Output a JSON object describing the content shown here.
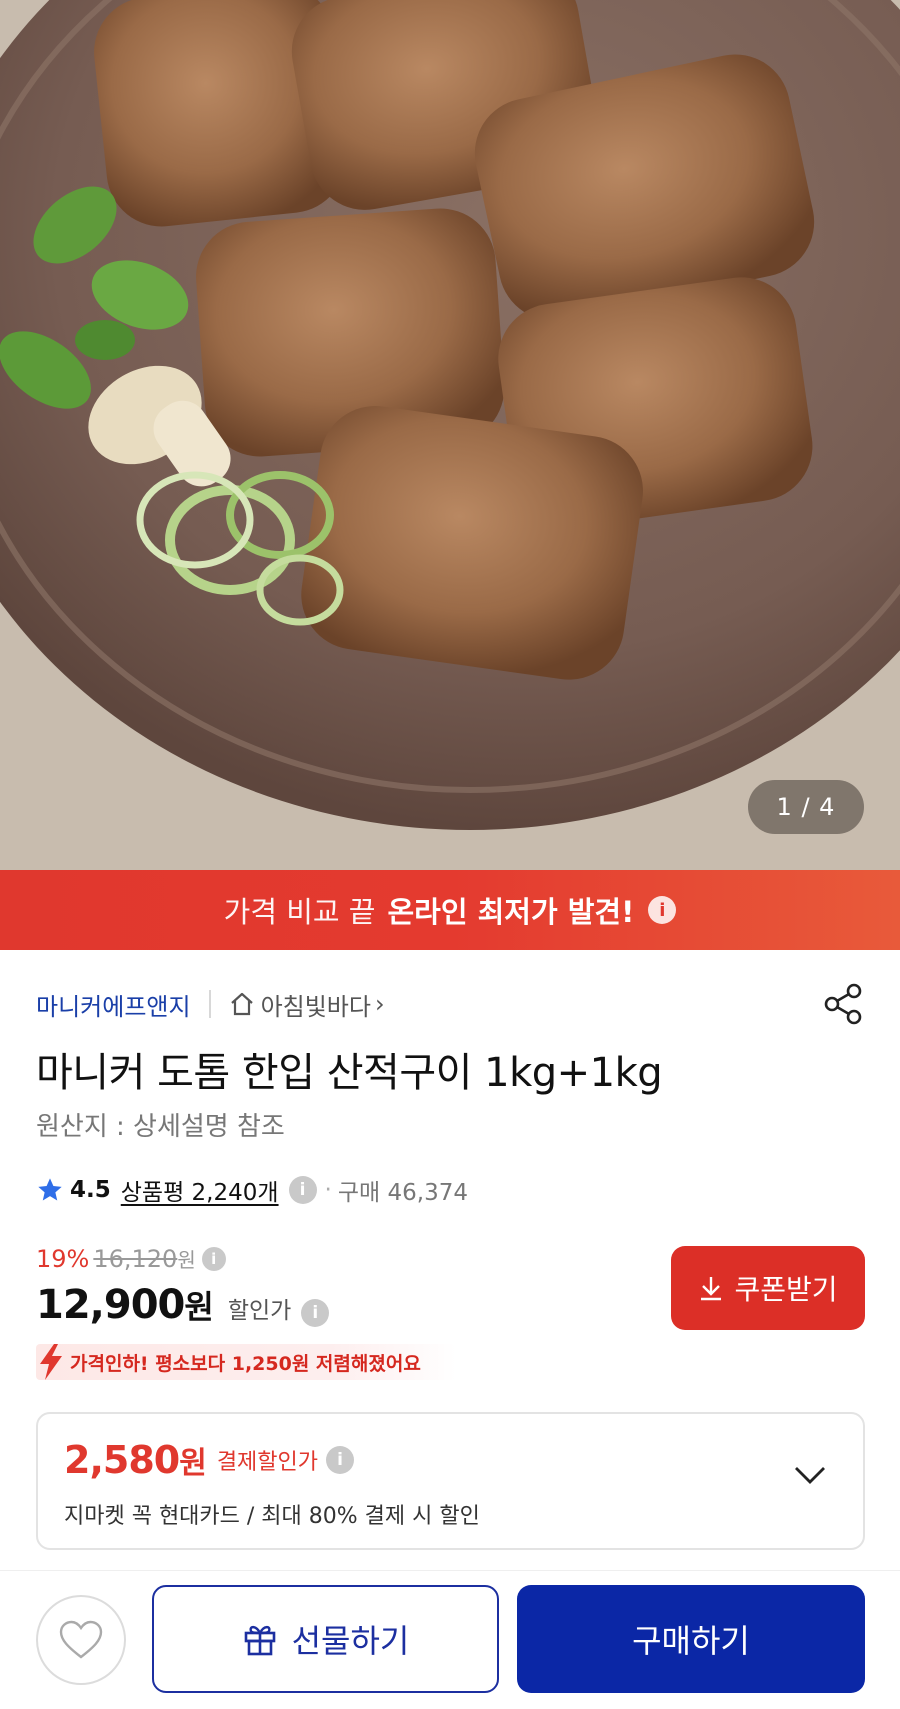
{
  "gallery": {
    "counter": "1 / 4",
    "image_description_icon": "food-photo"
  },
  "banner": {
    "normal_text": "가격 비교 끝",
    "bold_text": "온라인 최저가 발견!",
    "info_glyph": "i"
  },
  "seller": {
    "brand": "마니커에프앤지",
    "store": "아침빛바다",
    "store_arrow": "›"
  },
  "product": {
    "title": "마니커 도톰 한입 산적구이 1kg+1kg",
    "origin": "원산지 : 상세설명 참조"
  },
  "rating": {
    "score": "4.5",
    "review_label": "상품평 2,240개",
    "info_glyph": "i",
    "separator": "·",
    "purchase_count": "구매 46,374"
  },
  "price": {
    "discount_pct": "19%",
    "original_price": "16,120",
    "original_won": "원",
    "current_price": "12,900",
    "current_won": "원",
    "current_label": "할인가",
    "info_glyph": "i",
    "coupon_label": "쿠폰받기",
    "drop_notice": "가격인하! 평소보다 1,250원 저렴해졌어요"
  },
  "payment": {
    "amount": "2,580",
    "won": "원",
    "label": "결제할인가",
    "info_glyph": "i",
    "description": "지마켓 꼭 현대카드 / 최대 80% 결제 시 할인"
  },
  "bottom_bar": {
    "gift_label": "선물하기",
    "buy_label": "구매하기"
  },
  "colors": {
    "accent_red": "#e0382e",
    "brand_blue": "#1a3fa8",
    "buy_blue": "#0b27a6",
    "star_blue": "#2f6ee8"
  }
}
